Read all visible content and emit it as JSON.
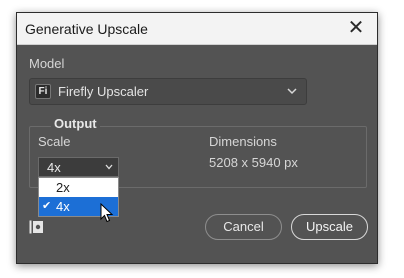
{
  "dialog": {
    "title": "Generative Upscale",
    "close_glyph": "✕"
  },
  "model": {
    "label": "Model",
    "icon_text": "Fi",
    "value": "Firefly Upscaler"
  },
  "output": {
    "legend": "Output",
    "scale_label": "Scale",
    "scale_value": "4x",
    "dimensions_label": "Dimensions",
    "dimensions_value": "5208 x 5940 px",
    "scale_options": [
      {
        "label": "2x",
        "selected": false
      },
      {
        "label": "4x",
        "selected": true
      }
    ]
  },
  "buttons": {
    "cancel": "Cancel",
    "confirm": "Upscale"
  },
  "colors": {
    "dialog_bg": "#535353",
    "titlebar_bg": "#f3f3f3",
    "selection": "#1c6fd6"
  },
  "icons": {
    "model": "firefly-app-icon",
    "close": "close-icon",
    "chevron": "chevron-down-icon",
    "check": "checkmark-icon",
    "cursor": "mouse-pointer-icon",
    "preview": "preview-icon"
  }
}
